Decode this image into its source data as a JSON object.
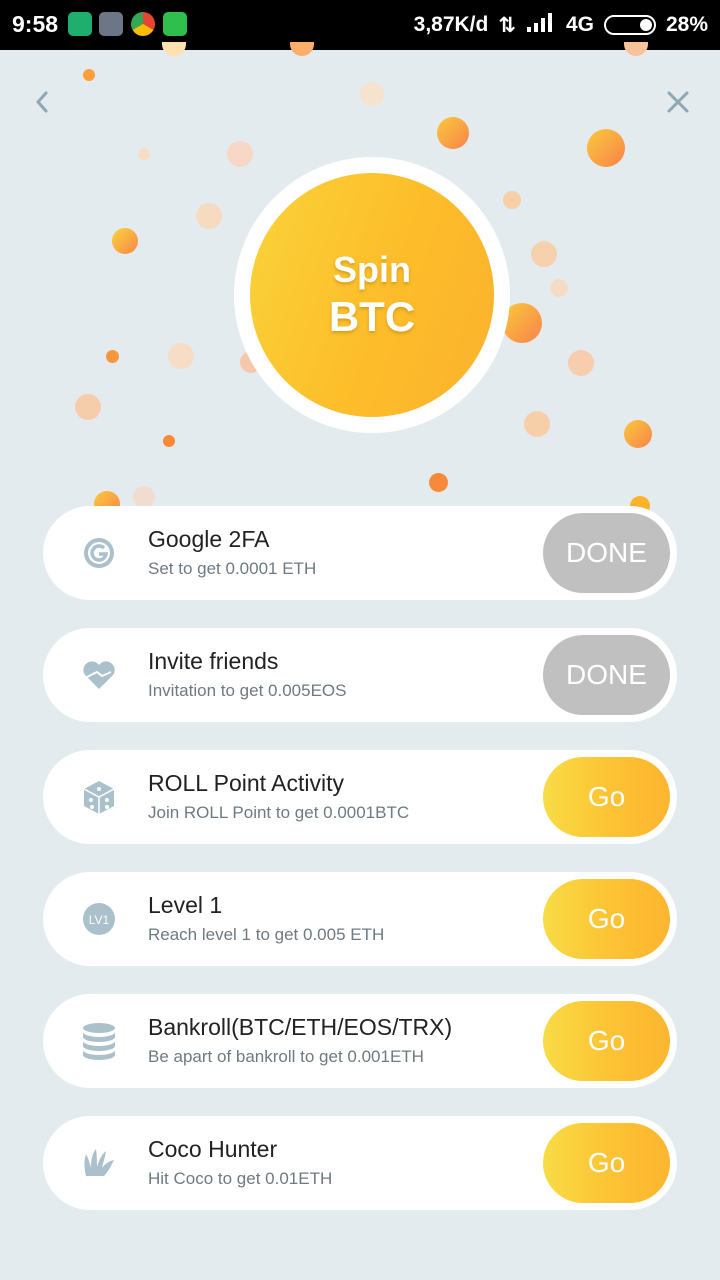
{
  "status_bar": {
    "time": "9:58",
    "network_speed": "3,87K/d",
    "network_type": "4G",
    "battery": "28%"
  },
  "nav": {
    "back_icon": "chevron-left-icon",
    "close_icon": "close-icon"
  },
  "spin": {
    "line1": "Spin",
    "line2": "BTC"
  },
  "tasks": [
    {
      "icon": "google-2fa-icon",
      "title": "Google 2FA",
      "subtitle": "Set to get 0.0001 ETH",
      "button": "DONE",
      "state": "done"
    },
    {
      "icon": "heart-icon",
      "title": "Invite friends",
      "subtitle": "Invitation to get 0.005EOS",
      "button": "DONE",
      "state": "done"
    },
    {
      "icon": "dice-icon",
      "title": "ROLL Point Activity",
      "subtitle": "Join ROLL Point to get 0.0001BTC",
      "button": "Go",
      "state": "go"
    },
    {
      "icon": "level-badge-icon",
      "icon_text": "LV1",
      "title": "Level 1",
      "subtitle": "Reach level 1 to get 0.005 ETH",
      "button": "Go",
      "state": "go"
    },
    {
      "icon": "coin-stack-icon",
      "title": "Bankroll(BTC/ETH/EOS/TRX)",
      "subtitle": "Be apart of bankroll to get 0.001ETH",
      "button": "Go",
      "state": "go"
    },
    {
      "icon": "claw-icon",
      "title": "Coco Hunter",
      "subtitle": "Hit Coco to get 0.01ETH",
      "button": "Go",
      "state": "go"
    }
  ],
  "colors": {
    "background": "#e4ebef",
    "accent_yellow": "#fcc435",
    "done_gray": "#c0c0c0",
    "icon_gray": "#aac0ca"
  }
}
